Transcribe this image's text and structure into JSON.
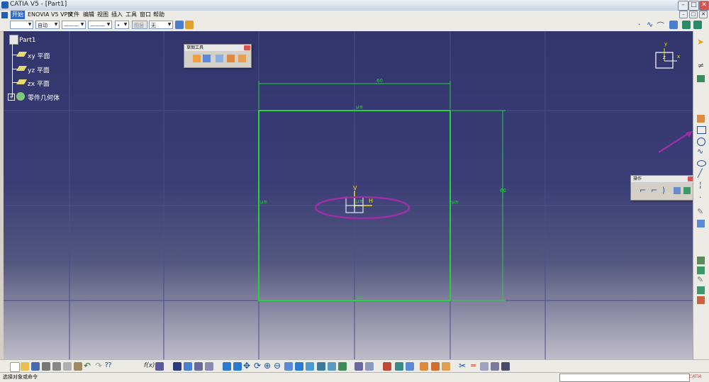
{
  "window": {
    "title": "CATIA V5 - [Part1]"
  },
  "menu": {
    "items": [
      "开始",
      "ENOVIA V5 VPM",
      "文件",
      "编辑",
      "视图",
      "插入",
      "工具",
      "窗口",
      "帮助"
    ]
  },
  "toolrow": {
    "style_combo": "",
    "color_combo": "自动",
    "linetype_combo": "———",
    "thickness_combo": "———",
    "point_combo": "•",
    "layer_combo": "图层",
    "layer_value": "无"
  },
  "tree": {
    "root": "Part1",
    "items": [
      "xy 平面",
      "yz 平面",
      "zx 平面",
      "零件几何体"
    ]
  },
  "sketch_tools": {
    "title": "草图工具"
  },
  "operations": {
    "title": "操作"
  },
  "sketch": {
    "dim_horizontal": "60",
    "dim_vertical": "60",
    "constraint_symbol": "μ≡",
    "axis_h": "H",
    "axis_v": "V"
  },
  "compass": {
    "x": "x",
    "y": "y",
    "z": "z"
  },
  "status": {
    "text": "选择对象或命令"
  },
  "colors": {
    "viewport_top": "#32356c",
    "sketch_green": "#22d33a",
    "annotation_purple": "#9b2fa6",
    "axis_yellow": "#f0e000"
  }
}
